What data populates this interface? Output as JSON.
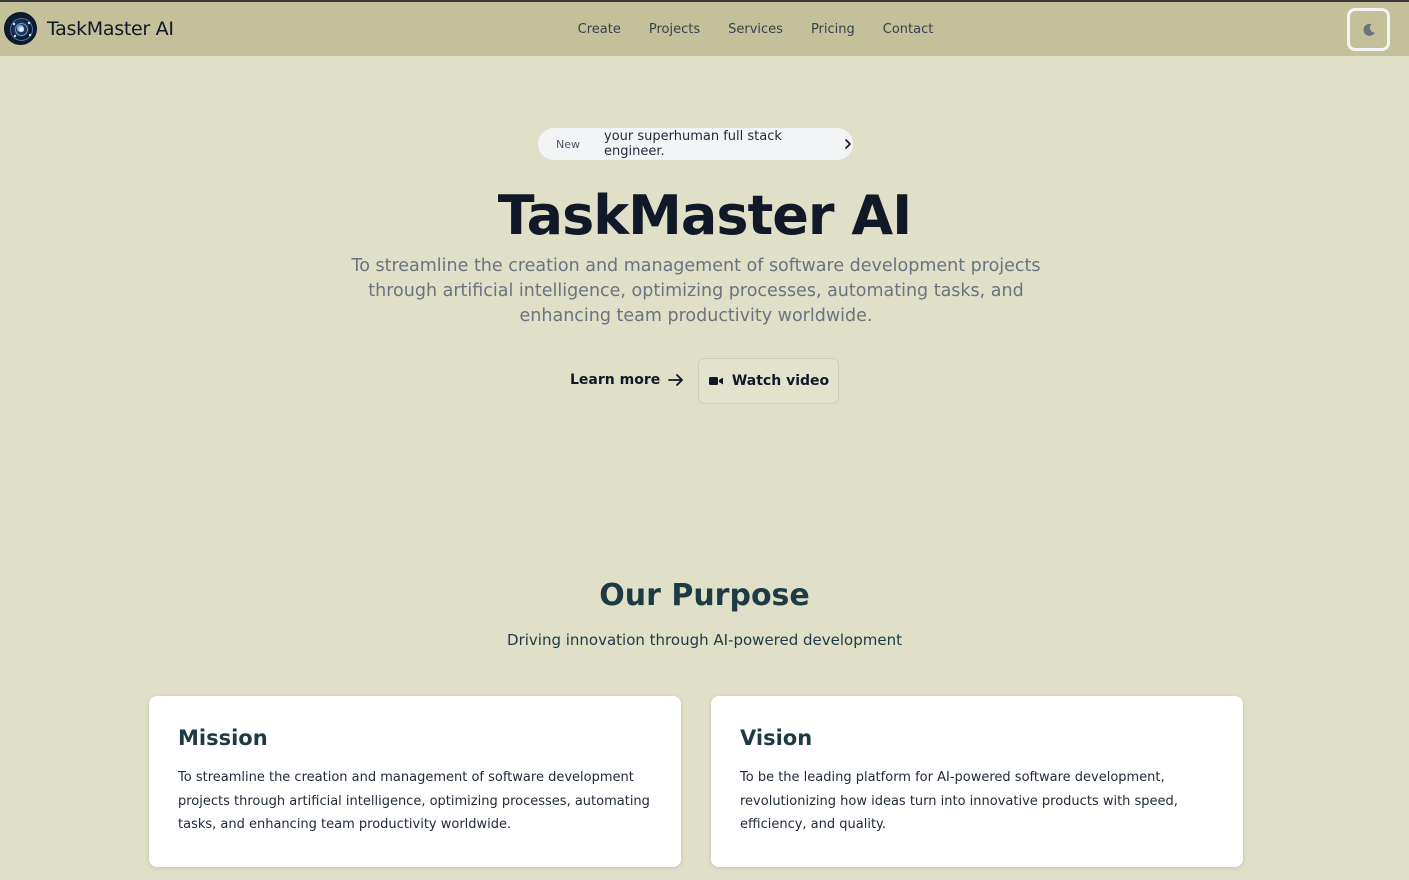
{
  "header": {
    "brand": "TaskMaster AI",
    "nav": [
      "Create",
      "Projects",
      "Services",
      "Pricing",
      "Contact"
    ],
    "theme_toggle_icon": "moon-icon"
  },
  "hero": {
    "pill_tag": "New",
    "pill_message": "your superhuman full stack engineer.",
    "title": "TaskMaster AI",
    "subtitle": "To streamline the creation and management of software development projects through artificial intelligence, optimizing processes, automating tasks, and enhancing team productivity worldwide.",
    "learn_more": "Learn more",
    "watch_video": "Watch video"
  },
  "purpose": {
    "title": "Our Purpose",
    "subtitle": "Driving innovation through AI-powered development",
    "cards": [
      {
        "title": "Mission",
        "text": "To streamline the creation and management of software development projects through artificial intelligence, optimizing processes, automating tasks, and enhancing team productivity worldwide."
      },
      {
        "title": "Vision",
        "text": "To be the leading platform for AI-powered software development, revolutionizing how ideas turn into innovative products with speed, efficiency, and quality."
      }
    ]
  },
  "colors": {
    "page_bg": "#e0dfc7",
    "header_bg": "#c3c09a",
    "heading_teal": "#1e3a44",
    "title_dark": "#111827"
  }
}
